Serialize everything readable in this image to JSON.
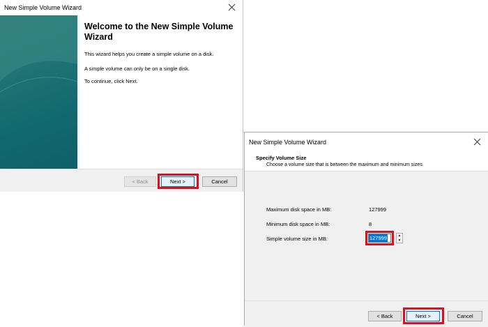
{
  "dialog1": {
    "title": "New Simple Volume Wizard",
    "heading": "Welcome to the New Simple Volume Wizard",
    "paragraphs": [
      "This wizard helps you create a simple volume on a disk.",
      "A simple volume can only be on a single disk.",
      "To continue, click Next."
    ],
    "buttons": {
      "back": "< Back",
      "next": "Next >",
      "cancel": "Cancel"
    }
  },
  "dialog2": {
    "title": "New Simple Volume Wizard",
    "page_title": "Specify Volume Size",
    "page_subtitle": "Choose a volume size that is between the maximum and minimum sizes.",
    "fields": {
      "max_label": "Maximum disk space in MB:",
      "max_value": "127999",
      "min_label": "Minimum disk space in MB:",
      "min_value": "8",
      "size_label": "Simple volume size in MB:",
      "size_value": "127999"
    },
    "buttons": {
      "back": "< Back",
      "next": "Next >",
      "cancel": "Cancel"
    }
  },
  "colors": {
    "highlight": "#d9121f",
    "selection": "#0078d7",
    "panel_teal": "#116a70"
  },
  "icons": [
    "close-icon",
    "spin-up-icon",
    "spin-down-icon"
  ]
}
